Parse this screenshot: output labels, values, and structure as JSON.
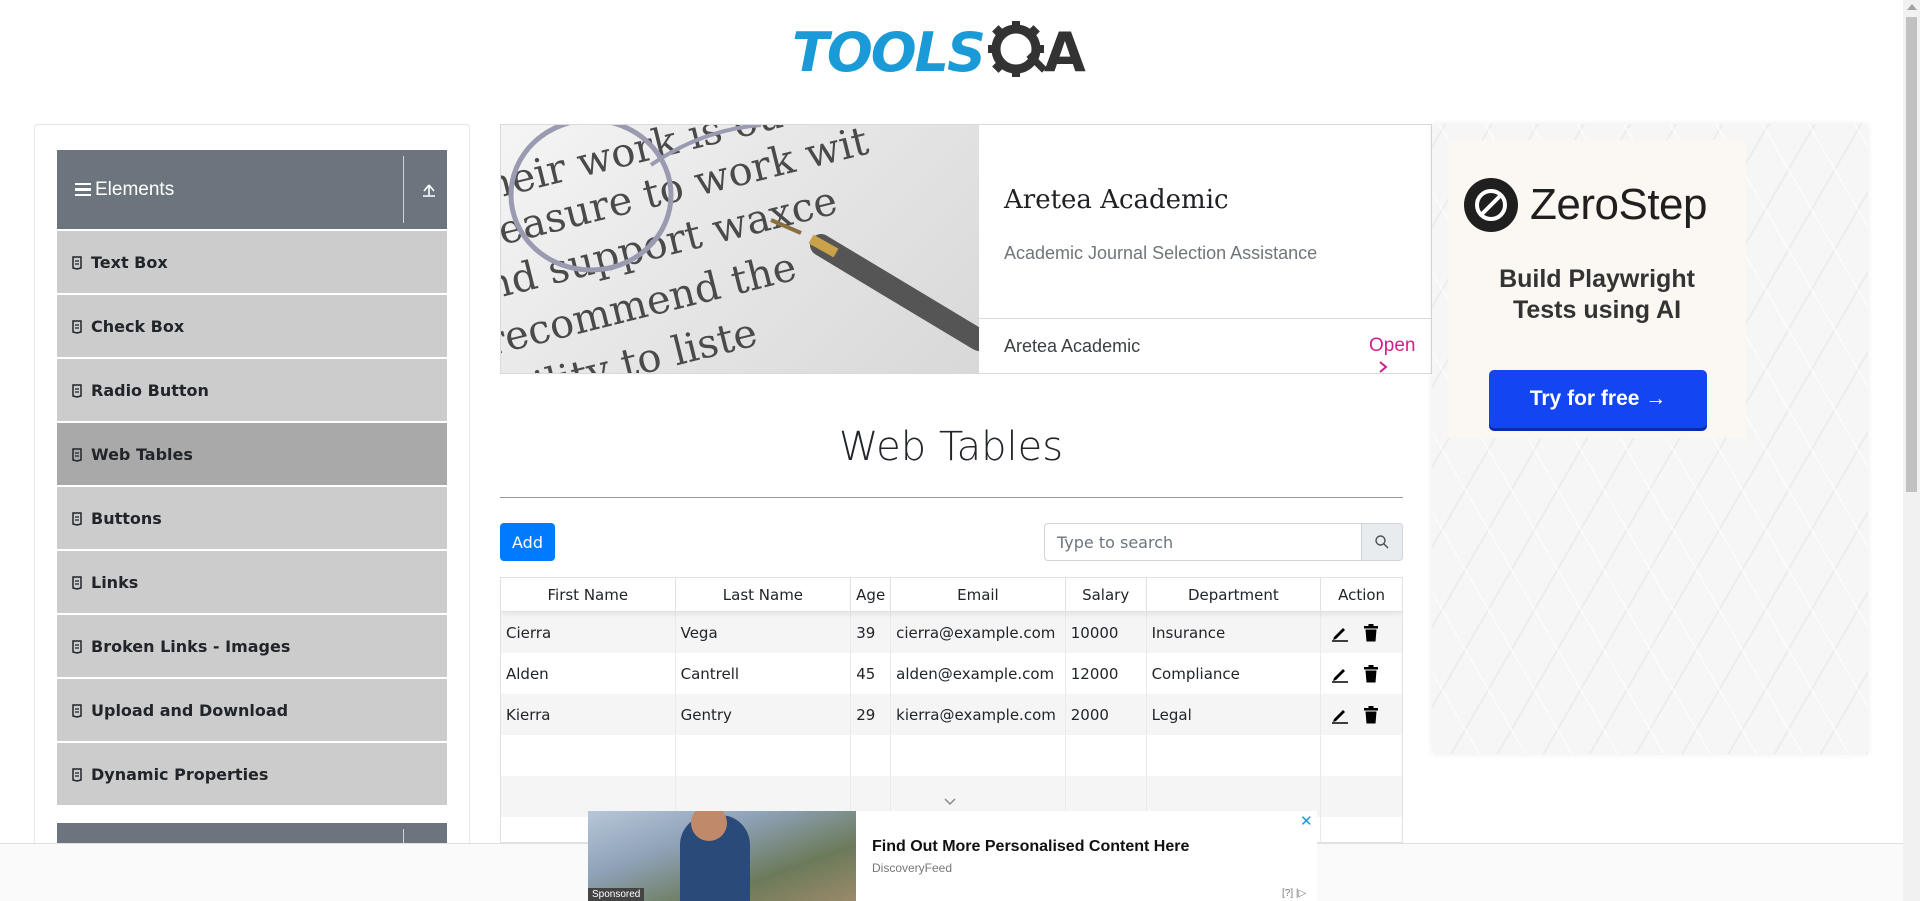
{
  "header": {
    "logo_main": "TOOLS",
    "logo_end": "A",
    "logo_gear_letter": "Q"
  },
  "sidebar": {
    "group_title": "Elements",
    "items": [
      {
        "label": "Text Box",
        "active": false
      },
      {
        "label": "Check Box",
        "active": false
      },
      {
        "label": "Radio Button",
        "active": false
      },
      {
        "label": "Web Tables",
        "active": true
      },
      {
        "label": "Buttons",
        "active": false
      },
      {
        "label": "Links",
        "active": false
      },
      {
        "label": "Broken Links - Images",
        "active": false
      },
      {
        "label": "Upload and Download",
        "active": false
      },
      {
        "label": "Dynamic Properties",
        "active": false
      }
    ]
  },
  "ad_card": {
    "title": "Aretea Academic",
    "subtitle": "Academic Journal Selection Assistance",
    "footer_name": "Aretea Academic",
    "open_label": "Open",
    "image_lines": [
      "heir work is outstandi",
      "leasure to work wit",
      "nd support waxce",
      "recommend the",
      "ability to liste"
    ]
  },
  "right_ad": {
    "brand": "ZeroStep",
    "tagline_line1": "Build Playwright",
    "tagline_line2": "Tests using AI",
    "cta": "Try for free →"
  },
  "main": {
    "title": "Web Tables",
    "add_label": "Add",
    "search_placeholder": "Type to search"
  },
  "table": {
    "columns": [
      "First Name",
      "Last Name",
      "Age",
      "Email",
      "Salary",
      "Department",
      "Action"
    ],
    "rows": [
      [
        "Cierra",
        "Vega",
        "39",
        "cierra@example.com",
        "10000",
        "Insurance"
      ],
      [
        "Alden",
        "Cantrell",
        "45",
        "alden@example.com",
        "12000",
        "Compliance"
      ],
      [
        "Kierra",
        "Gentry",
        "29",
        "kierra@example.com",
        "2000",
        "Legal"
      ]
    ]
  },
  "bottom_ad": {
    "headline": "Find Out More Personalised Content Here",
    "source": "DiscoveryFeed",
    "sponsored": "Sponsored",
    "close": "✕",
    "adinfo": "[?] |▷"
  },
  "colors": {
    "brand_blue": "#1a9ad6",
    "add_button": "#007bff",
    "sidebar_header": "#6c757d",
    "menu_item": "#cccccc",
    "menu_item_active": "#a9a9a9",
    "ad_open": "#d0208a",
    "cta_blue": "#1346f0"
  }
}
